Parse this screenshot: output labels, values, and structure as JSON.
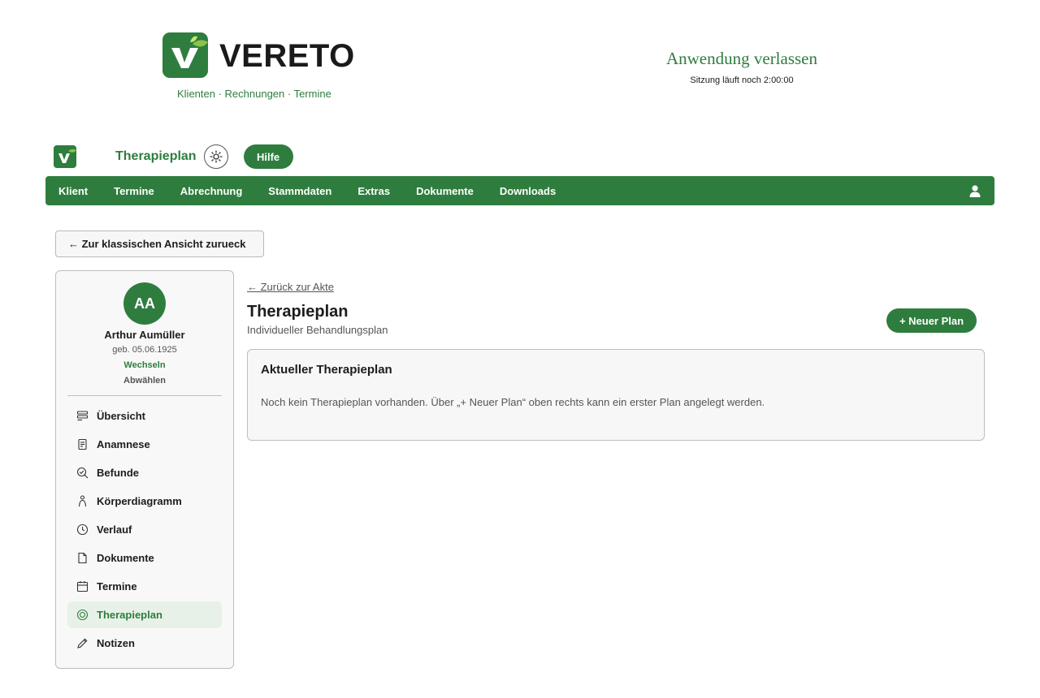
{
  "brand": {
    "name": "VERETO",
    "tagline": "Klienten · Rechnungen · Termine"
  },
  "session": {
    "exit_label": "Anwendung verlassen",
    "status": "Sitzung läuft noch 2:00:00"
  },
  "subheader": {
    "page_name": "Therapieplan",
    "theme_icon": "sun-icon",
    "help_label": "Hilfe"
  },
  "nav": {
    "items": [
      "Klient",
      "Termine",
      "Abrechnung",
      "Stammdaten",
      "Extras",
      "Dokumente",
      "Downloads"
    ],
    "user_icon": "user-icon"
  },
  "classic_view_label": "← Zur klassischen Ansicht zurueck",
  "client": {
    "initials": "AA",
    "name": "Arthur Aumüller",
    "dob": "geb. 05.06.1925",
    "switch_label": "Wechseln",
    "deselect_label": "Abwählen"
  },
  "sidebar": {
    "items": [
      {
        "label": "Übersicht",
        "icon": "overview-icon"
      },
      {
        "label": "Anamnese",
        "icon": "clipboard-icon"
      },
      {
        "label": "Befunde",
        "icon": "search-check-icon"
      },
      {
        "label": "Körperdiagramm",
        "icon": "person-icon"
      },
      {
        "label": "Verlauf",
        "icon": "clock-icon"
      },
      {
        "label": "Dokumente",
        "icon": "document-icon"
      },
      {
        "label": "Termine",
        "icon": "calendar-icon"
      },
      {
        "label": "Therapieplan",
        "icon": "target-icon",
        "active": true
      },
      {
        "label": "Notizen",
        "icon": "pencil-icon"
      }
    ]
  },
  "main": {
    "back_label": "← Zurück zur Akte",
    "title": "Therapieplan",
    "subtitle": "Individueller Behandlungsplan",
    "new_plan_label": "+ Neuer Plan",
    "card": {
      "title": "Aktueller Therapieplan",
      "empty_text": "Noch kein Therapieplan vorhanden. Über „+ Neuer Plan“ oben rechts kann ein erster Plan angelegt werden."
    }
  },
  "colors": {
    "accent": "#2e7d3e",
    "leaf": "#8bc34a",
    "active_bg": "#e7f1e8"
  }
}
